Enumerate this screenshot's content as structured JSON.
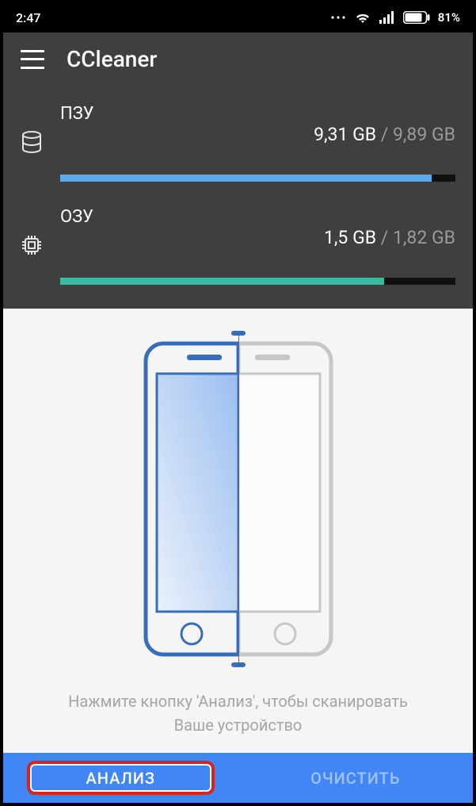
{
  "statusBar": {
    "time": "2:47",
    "batteryPct": "81%"
  },
  "app": {
    "title": "CCleaner"
  },
  "storage": {
    "label": "ПЗУ",
    "used": "9,31 GB",
    "sep": " / ",
    "total": "9,89 GB",
    "pct": 94
  },
  "ram": {
    "label": "ОЗУ",
    "used": "1,5 GB",
    "sep": " / ",
    "total": "1,82 GB",
    "pct": 82
  },
  "main": {
    "hintLine1": "Нажмите кнопку 'Анализ', чтобы сканировать",
    "hintLine2": "Ваше устройство"
  },
  "buttons": {
    "analyze": "АНАЛИЗ",
    "clean": "ОЧИСТИТЬ"
  }
}
